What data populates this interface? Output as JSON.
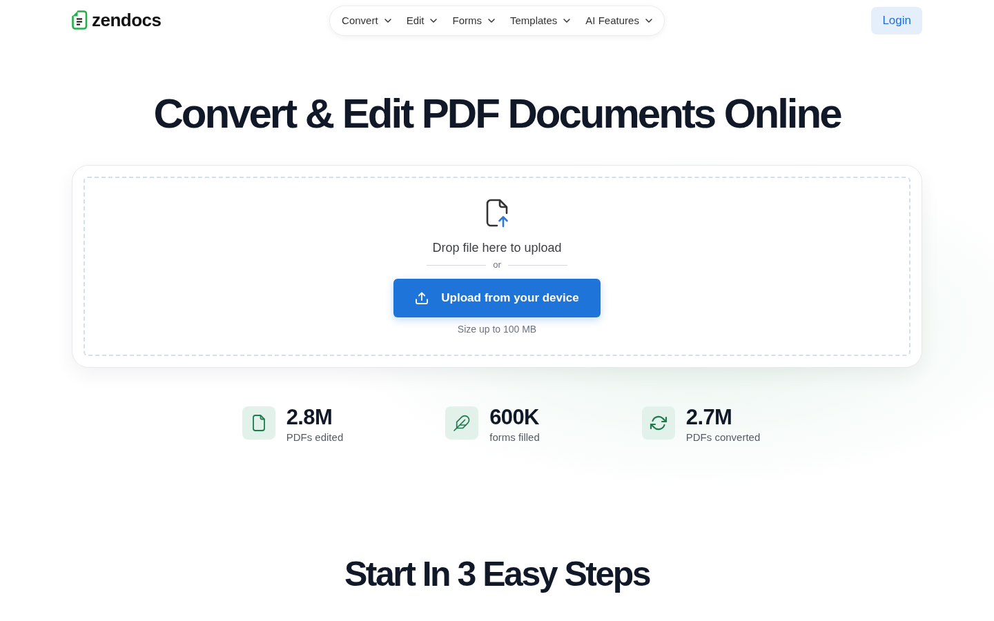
{
  "header": {
    "logo": {
      "text": "zendocs"
    },
    "nav": [
      {
        "label": "Convert"
      },
      {
        "label": "Edit"
      },
      {
        "label": "Forms"
      },
      {
        "label": "Templates"
      },
      {
        "label": "AI Features"
      }
    ],
    "login": "Login"
  },
  "hero": {
    "title": "Convert & Edit PDF Documents Online"
  },
  "upload": {
    "prompt": "Drop file here to upload",
    "divider": "or",
    "button": "Upload from your device",
    "note": "Size up to 100 MB"
  },
  "stats": [
    {
      "kind": "document",
      "value": "2.8M",
      "label": "PDFs edited"
    },
    {
      "kind": "feather",
      "value": "600K",
      "label": "forms filled"
    },
    {
      "kind": "refresh",
      "value": "2.7M",
      "label": "PDFs converted"
    }
  ],
  "steps": {
    "title": "Start In 3 Easy Steps"
  }
}
